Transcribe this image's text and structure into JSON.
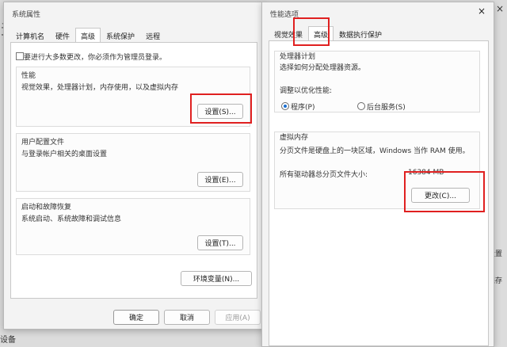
{
  "background": {
    "left_glyph": "多",
    "bottom_left": "设备",
    "right_top": "×",
    "right_mid1": "设置",
    "right_mid2": "保存"
  },
  "sys_window": {
    "title": "系统属性",
    "tabs": [
      "计算机名",
      "硬件",
      "高级",
      "系统保护",
      "远程"
    ],
    "admin_note": "要进行大多数更改，你必须作为管理员登录。",
    "perf": {
      "title": "性能",
      "desc": "视觉效果，处理器计划，内存使用，以及虚拟内存",
      "button": "设置(S)..."
    },
    "profile": {
      "title": "用户配置文件",
      "desc": "与登录帐户相关的桌面设置",
      "button": "设置(E)..."
    },
    "startup": {
      "title": "启动和故障恢复",
      "desc": "系统启动、系统故障和调试信息",
      "button": "设置(T)..."
    },
    "env_button": "环境变量(N)...",
    "ok": "确定",
    "cancel": "取消",
    "apply": "应用(A)"
  },
  "perf_window": {
    "title": "性能选项",
    "tabs": [
      "视觉效果",
      "高级",
      "数据执行保护"
    ],
    "cpu": {
      "title": "处理器计划",
      "desc": "选择如何分配处理器资源。",
      "adjust": "调整以优化性能:",
      "opt_programs": "程序(P)",
      "opt_services": "后台服务(S)"
    },
    "vm": {
      "title": "虚拟内存",
      "desc": "分页文件是硬盘上的一块区域，Windows 当作 RAM 使用。",
      "total_label": "所有驱动器总分页文件大小:",
      "total_value": "16384 MB",
      "button": "更改(C)..."
    }
  }
}
